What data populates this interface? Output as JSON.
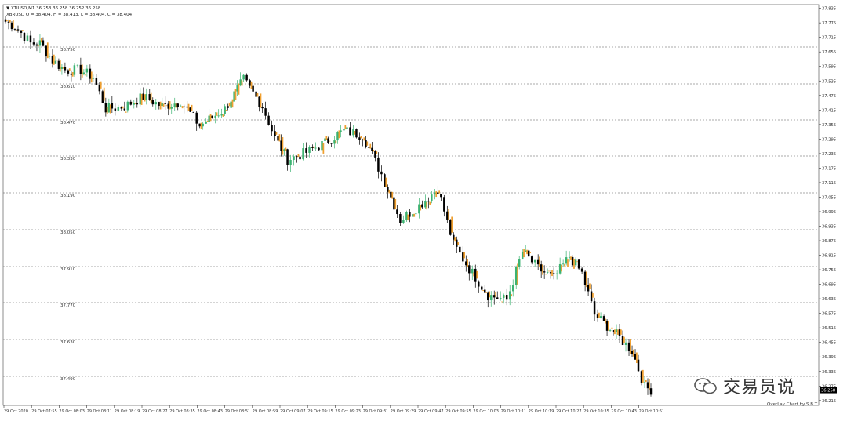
{
  "header": {
    "line1": "▼ XTIUSD,M1  36.253 36.258 36.252 36.258",
    "line2": "XBRUSD O = 38.404, H = 38.413, L = 38.404, C = 38.404"
  },
  "colors": {
    "bull": "#3cb371",
    "bear": "#000000",
    "overlay": "#f0a030",
    "grid": "#555555",
    "axis": "#333333"
  },
  "chart_data": {
    "type": "candlestick",
    "title": "",
    "instrument": "XTIUSD,M1",
    "overlay_instrument": "XBRUSD",
    "right_axis_ticks": [
      "37.835",
      "37.775",
      "37.715",
      "37.655",
      "37.595",
      "37.535",
      "37.475",
      "37.415",
      "37.355",
      "37.295",
      "37.235",
      "37.175",
      "37.115",
      "37.055",
      "36.995",
      "36.935",
      "36.875",
      "36.815",
      "36.755",
      "36.695",
      "36.635",
      "36.575",
      "36.515",
      "36.455",
      "36.395",
      "36.335",
      "36.275",
      "36.215"
    ],
    "right_axis_range": [
      36.195,
      37.85
    ],
    "left_axis_ticks": [
      "38.750",
      "38.610",
      "38.470",
      "38.330",
      "38.190",
      "38.050",
      "37.910",
      "37.770",
      "37.630",
      "37.490"
    ],
    "current_price_label": "36.258",
    "current_price": 36.258,
    "x_labels": [
      "29 Oct 2020",
      "29 Oct 07:55",
      "29 Oct 08:03",
      "29 Oct 08:11",
      "29 Oct 08:19",
      "29 Oct 08:27",
      "29 Oct 08:35",
      "29 Oct 08:43",
      "29 Oct 08:51",
      "29 Oct 08:59",
      "29 Oct 09:07",
      "29 Oct 09:15",
      "29 Oct 09:23",
      "29 Oct 09:31",
      "29 Oct 09:39",
      "29 Oct 09:47",
      "29 Oct 09:55",
      "29 Oct 10:03",
      "29 Oct 10:11",
      "29 Oct 10:19",
      "29 Oct 10:27",
      "29 Oct 10:35",
      "29 Oct 10:43",
      "29 Oct 10:51"
    ],
    "anchors": [
      [
        0,
        37.78
      ],
      [
        3,
        37.76
      ],
      [
        6,
        37.72
      ],
      [
        8,
        37.69
      ],
      [
        11,
        37.69
      ],
      [
        15,
        37.62
      ],
      [
        19,
        37.58
      ],
      [
        24,
        37.58
      ],
      [
        28,
        37.55
      ],
      [
        32,
        37.42
      ],
      [
        38,
        37.43
      ],
      [
        44,
        37.47
      ],
      [
        50,
        37.43
      ],
      [
        56,
        37.45
      ],
      [
        62,
        37.35
      ],
      [
        70,
        37.42
      ],
      [
        76,
        37.54
      ],
      [
        82,
        37.43
      ],
      [
        86,
        37.3
      ],
      [
        90,
        37.21
      ],
      [
        96,
        37.24
      ],
      [
        102,
        37.28
      ],
      [
        108,
        37.33
      ],
      [
        114,
        37.31
      ],
      [
        120,
        37.15
      ],
      [
        126,
        36.96
      ],
      [
        132,
        37.02
      ],
      [
        138,
        37.09
      ],
      [
        143,
        36.86
      ],
      [
        148,
        36.76
      ],
      [
        154,
        36.65
      ],
      [
        160,
        36.63
      ],
      [
        165,
        36.83
      ],
      [
        170,
        36.76
      ],
      [
        175,
        36.72
      ],
      [
        180,
        36.81
      ],
      [
        184,
        36.74
      ],
      [
        188,
        36.57
      ],
      [
        194,
        36.5
      ],
      [
        200,
        36.42
      ],
      [
        204,
        36.27
      ],
      [
        206,
        36.26
      ]
    ],
    "candle_count": 207,
    "grid": "dashed horizontal",
    "watermark": "交易员说",
    "credit": "OverLay Chart by S.B.T"
  }
}
